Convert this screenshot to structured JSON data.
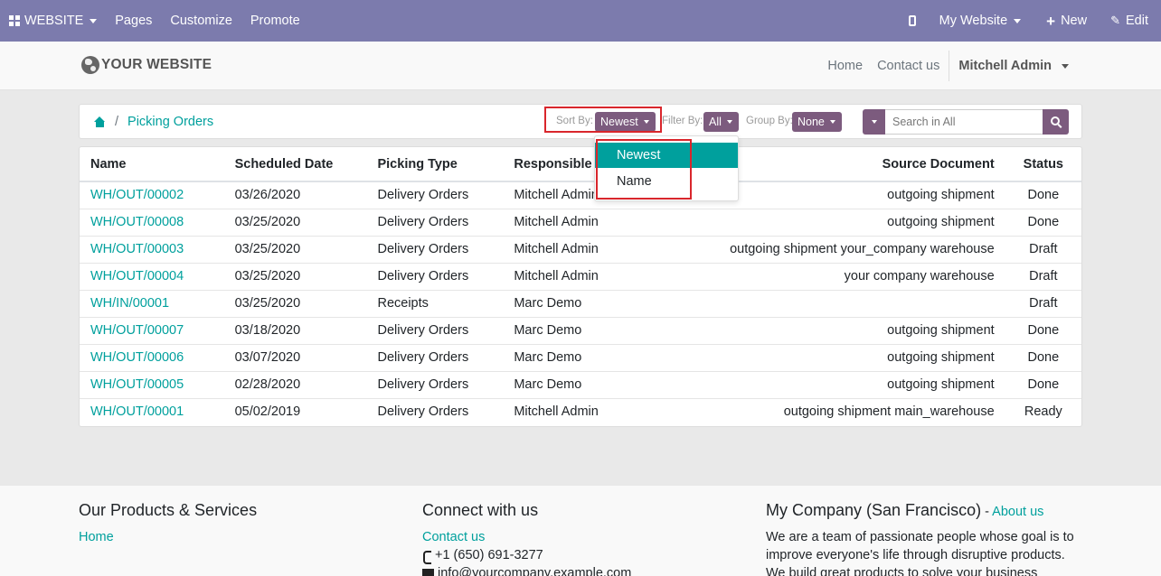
{
  "adminbar": {
    "website_label": "WEBSITE",
    "menu": [
      "Pages",
      "Customize",
      "Promote"
    ],
    "my_website": "My Website",
    "new_label": "New",
    "edit_label": "Edit"
  },
  "header": {
    "logo_text": "YOUR WEBSITE",
    "nav": [
      "Home",
      "Contact us"
    ],
    "user": "Mitchell Admin"
  },
  "breadcrumb": {
    "current": "Picking Orders",
    "separator": "/"
  },
  "controls": {
    "sort_label": "Sort By:",
    "sort_value": "Newest",
    "filter_label": "Filter By:",
    "filter_value": "All",
    "group_label": "Group By:",
    "group_value": "None",
    "search_placeholder": "Search in All"
  },
  "sort_dropdown": {
    "options": [
      "Newest",
      "Name"
    ],
    "selected": "Newest"
  },
  "table": {
    "headers": {
      "name": "Name",
      "scheduled_date": "Scheduled Date",
      "picking_type": "Picking Type",
      "responsible": "Responsible",
      "source_document": "Source Document",
      "status": "Status"
    },
    "rows": [
      [
        "WH/OUT/00002",
        "03/26/2020",
        "Delivery Orders",
        "Mitchell Admin",
        "outgoing shipment",
        "Done"
      ],
      [
        "WH/OUT/00008",
        "03/25/2020",
        "Delivery Orders",
        "Mitchell Admin",
        "outgoing shipment",
        "Done"
      ],
      [
        "WH/OUT/00003",
        "03/25/2020",
        "Delivery Orders",
        "Mitchell Admin",
        "outgoing shipment your_company warehouse",
        "Draft"
      ],
      [
        "WH/OUT/00004",
        "03/25/2020",
        "Delivery Orders",
        "Mitchell Admin",
        "your company warehouse",
        "Draft"
      ],
      [
        "WH/IN/00001",
        "03/25/2020",
        "Receipts",
        "Marc Demo",
        "",
        "Draft"
      ],
      [
        "WH/OUT/00007",
        "03/18/2020",
        "Delivery Orders",
        "Marc Demo",
        "outgoing shipment",
        "Done"
      ],
      [
        "WH/OUT/00006",
        "03/07/2020",
        "Delivery Orders",
        "Marc Demo",
        "outgoing shipment",
        "Done"
      ],
      [
        "WH/OUT/00005",
        "02/28/2020",
        "Delivery Orders",
        "Marc Demo",
        "outgoing shipment",
        "Done"
      ],
      [
        "WH/OUT/00001",
        "05/02/2019",
        "Delivery Orders",
        "Mitchell Admin",
        "outgoing shipment main_warehouse",
        "Ready"
      ]
    ]
  },
  "footer": {
    "col1_title": "Our Products & Services",
    "col1_link": "Home",
    "col2_title": "Connect with us",
    "col2_link": "Contact us",
    "phone": "+1 (650) 691-3277",
    "email": "info@yourcompany.example.com",
    "col3_title": "My Company (San Francisco)",
    "col3_dash": " - ",
    "col3_link": "About us",
    "col3_text": "We are a team of passionate people whose goal is to improve everyone's life through disruptive products. We build great products to solve your business problems."
  },
  "colors": {
    "adminbar": "#7c7bad",
    "accent": "#00a09d",
    "control": "#7c5b7e",
    "highlight_box": "#d9262c"
  }
}
